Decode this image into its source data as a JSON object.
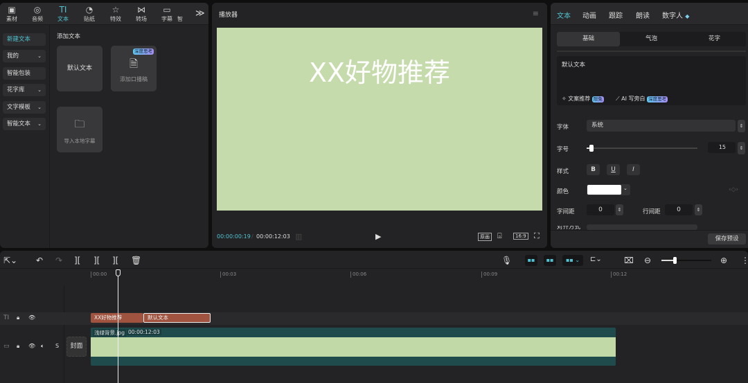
{
  "media_tabs": [
    {
      "label": "素材",
      "icon": "media-icon"
    },
    {
      "label": "音频",
      "icon": "audio-icon"
    },
    {
      "label": "文本",
      "icon": "text-icon",
      "active": true
    },
    {
      "label": "贴纸",
      "icon": "sticker-icon"
    },
    {
      "label": "特效",
      "icon": "effects-icon"
    },
    {
      "label": "转场",
      "icon": "transition-icon"
    },
    {
      "label": "字幕",
      "icon": "subtitle-icon"
    },
    {
      "label": "智",
      "icon": ""
    }
  ],
  "text_sidebar": [
    {
      "label": "新建文本",
      "active": true
    },
    {
      "label": "我的",
      "dropdown": true
    },
    {
      "label": "智能包装"
    },
    {
      "label": "花字库",
      "dropdown": true
    },
    {
      "label": "文字模板",
      "dropdown": true
    },
    {
      "label": "智能文本",
      "dropdown": true
    }
  ],
  "add_text": {
    "title": "添加文本",
    "default_text": "默认文本",
    "add_script": "添加口播稿",
    "deep_badge": "深度思考",
    "import_subtitle": "导入本地字幕"
  },
  "player": {
    "title": "播放器",
    "preview_text": "XX好物推荐",
    "preview_bg": "#c5dbab",
    "current_time": "00:00:00:19",
    "total_time": "00:00:12:03",
    "original_label": "原画",
    "ratio_label": "16:9"
  },
  "inspector": {
    "tabs": [
      "文本",
      "动画",
      "跟踪",
      "朗读",
      "数字人"
    ],
    "subtabs": [
      "基础",
      "气泡",
      "花字"
    ],
    "text_value": "默认文本",
    "copy_suggest": "文案推荐",
    "limited_badge": "限免",
    "ai_write": "AI 写旁白",
    "deep_badge": "深度思考",
    "font_label": "字体",
    "font_value": "系统",
    "size_label": "字号",
    "size_value": "15",
    "size_fraction": 0.03,
    "style_label": "样式",
    "style_buttons": [
      "B",
      "U",
      "I"
    ],
    "color_label": "颜色",
    "color_value": "#ffffff",
    "char_spacing_label": "字间距",
    "char_spacing_value": "0",
    "line_spacing_label": "行间距",
    "line_spacing_value": "0",
    "align_label": "对齐方式",
    "save_preset": "保存预设"
  },
  "timeline": {
    "ruler": [
      "00:00",
      "00:03",
      "00:06",
      "00:09",
      "00:12"
    ],
    "text_clips": [
      "XX好物推荐",
      "默认文本"
    ],
    "video_clip_name": "浅绿背景.jpg",
    "video_clip_duration": "00:00:12:03",
    "cover_label": "封面",
    "zoom_fraction": 0.27
  }
}
